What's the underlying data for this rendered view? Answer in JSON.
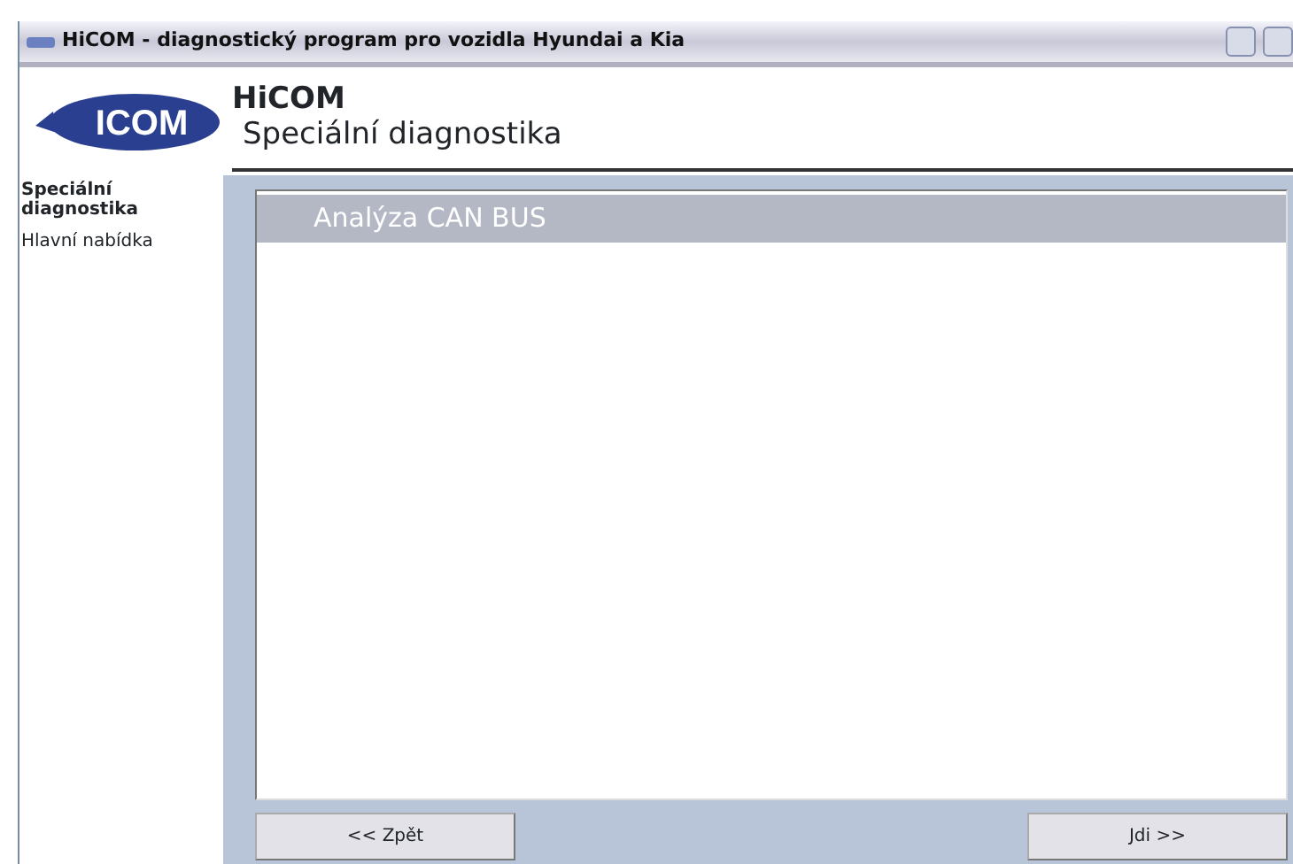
{
  "window": {
    "title": "HiCOM - diagnostický program pro vozidla Hyundai a Kia"
  },
  "header": {
    "logo_text": "ICOM",
    "title": "HiCOM",
    "subtitle": "Speciální diagnostika"
  },
  "sidebar": {
    "items": [
      {
        "label": "Speciální diagnostika",
        "selected": true
      },
      {
        "label": "Hlavní nabídka",
        "selected": false
      }
    ]
  },
  "list": {
    "items": [
      {
        "label": "Analýza CAN BUS",
        "selected": true
      }
    ]
  },
  "buttons": [
    {
      "label": "<< Zpět"
    },
    {
      "label": "Jdi >>"
    }
  ]
}
